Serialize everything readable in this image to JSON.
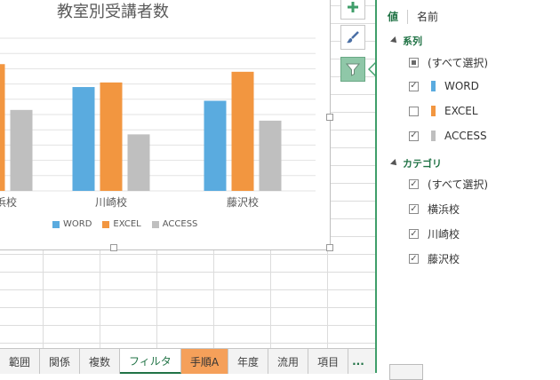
{
  "chart": {
    "title": "教室別受講者数"
  },
  "chart_data": {
    "type": "bar",
    "title": "教室別受講者数",
    "categories": [
      "横浜校",
      "川崎校",
      "藤沢校"
    ],
    "visible_category_labels": [
      "浜校",
      "川崎校",
      "藤沢校"
    ],
    "series": [
      {
        "name": "WORD",
        "color": "#5aabdf",
        "values": [
          null,
          68,
          59
        ]
      },
      {
        "name": "EXCEL",
        "color": "#f29640",
        "values": [
          83,
          71,
          78
        ]
      },
      {
        "name": "ACCESS",
        "color": "#bfbfbf",
        "values": [
          53,
          37,
          46
        ]
      }
    ],
    "ylim": [
      0,
      100
    ],
    "grid": true,
    "legend": "bottom"
  },
  "side_buttons": {
    "add": "plus-icon",
    "style": "brush-icon",
    "filter": "filter-icon"
  },
  "pane": {
    "tabs": [
      {
        "label": "値",
        "active": true
      },
      {
        "label": "名前",
        "active": false
      }
    ],
    "series_header": "系列",
    "series_items": [
      {
        "label": "(すべて選択)",
        "state": "mixed"
      },
      {
        "label": "WORD",
        "state": "checked",
        "color": "#5aabdf"
      },
      {
        "label": "EXCEL",
        "state": "unchecked",
        "color": "#f29640"
      },
      {
        "label": "ACCESS",
        "state": "checked",
        "color": "#bfbfbf"
      }
    ],
    "category_header": "カテゴリ",
    "category_items": [
      {
        "label": "(すべて選択)",
        "state": "checked"
      },
      {
        "label": "横浜校",
        "state": "checked"
      },
      {
        "label": "川崎校",
        "state": "checked"
      },
      {
        "label": "藤沢校",
        "state": "checked"
      }
    ]
  },
  "sheet_tabs": [
    {
      "label": "範囲",
      "style": "normal"
    },
    {
      "label": "関係",
      "style": "normal"
    },
    {
      "label": "複数",
      "style": "normal"
    },
    {
      "label": "フィルタ",
      "style": "active"
    },
    {
      "label": "手順A",
      "style": "orange"
    },
    {
      "label": "年度",
      "style": "normal"
    },
    {
      "label": "流用",
      "style": "normal"
    },
    {
      "label": "項目",
      "style": "normal"
    }
  ],
  "sheet_more": "..."
}
